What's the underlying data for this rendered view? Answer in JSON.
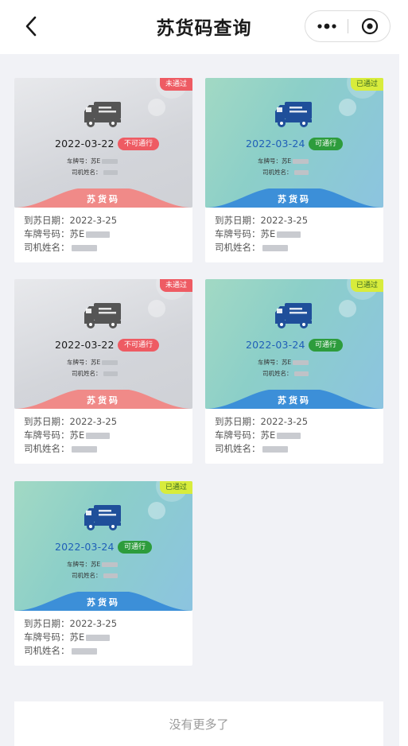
{
  "nav": {
    "title": "苏货码查询",
    "back_icon": "chevron-left-icon",
    "more_icon": "more-dots-icon",
    "close_icon": "target-circle-icon"
  },
  "colors": {
    "denied_red": "#ee5b63",
    "passed_yellow": "#d8ec3c",
    "pass_green": "#2d9c3c",
    "truck_gray": "#555555",
    "truck_blue": "#1f4f9a",
    "hill_red": "#f08a88",
    "hill_blue": "#3c8fd8",
    "background": "#f1f2f6"
  },
  "labels": {
    "plate_field": "车牌号：苏E",
    "driver_field": "司机姓名：",
    "brand": "苏货码",
    "arrival_label": "到苏日期：",
    "plate_label": "车牌号码：",
    "plate_prefix": "苏E",
    "driver_label": "司机姓名："
  },
  "cards": [
    {
      "status_tag": "未通过",
      "pass_date": "2022-03-22",
      "pass_status": "不可通行",
      "arrival_date": "2022-3-25",
      "theme": "gray"
    },
    {
      "status_tag": "已通过",
      "pass_date": "2022-03-24",
      "pass_status": "可通行",
      "arrival_date": "2022-3-25",
      "theme": "green"
    },
    {
      "status_tag": "未通过",
      "pass_date": "2022-03-22",
      "pass_status": "不可通行",
      "arrival_date": "2022-3-25",
      "theme": "gray"
    },
    {
      "status_tag": "已通过",
      "pass_date": "2022-03-24",
      "pass_status": "可通行",
      "arrival_date": "2022-3-25",
      "theme": "green"
    },
    {
      "status_tag": "已通过",
      "pass_date": "2022-03-24",
      "pass_status": "可通行",
      "arrival_date": "2022-3-25",
      "theme": "green"
    }
  ],
  "footer": {
    "no_more": "没有更多了"
  }
}
